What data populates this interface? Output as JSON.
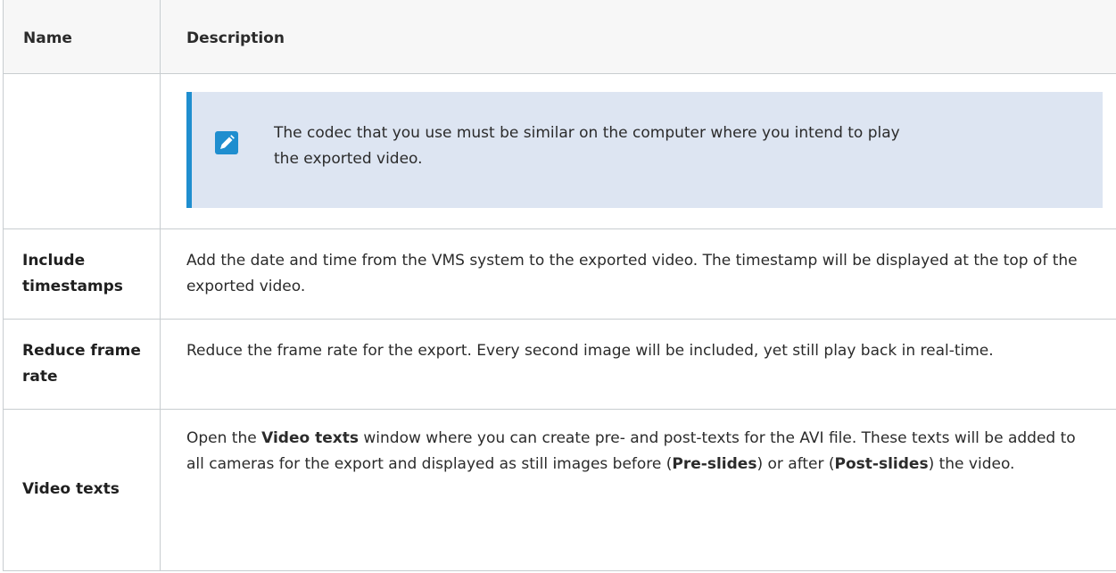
{
  "header": {
    "name": "Name",
    "description": "Description"
  },
  "note": {
    "icon": "pencil-note-icon",
    "text": "The codec that you use must be similar on the computer where you intend to play the exported video.",
    "accent_color": "#1f8ecf",
    "background_color": "#dde5f2"
  },
  "rows": [
    {
      "name": "Include timestamps",
      "description": "Add the date and time from the VMS system to the exported video. The timestamp will be displayed at the top of the exported video."
    },
    {
      "name": "Reduce frame rate",
      "description": "Reduce the frame rate for the export. Every second image will be included, yet still play back in real-time."
    },
    {
      "name": "Video texts",
      "description_parts": {
        "p1": "Open the ",
        "b1": "Video texts",
        "p2": " window where you can create pre- and post-texts for the AVI file. These texts will be added to all cameras for the export and displayed as still images before (",
        "b2": "Pre-slides",
        "p3": ") or after (",
        "b3": "Post-slides",
        "p4": ") the video."
      }
    }
  ]
}
